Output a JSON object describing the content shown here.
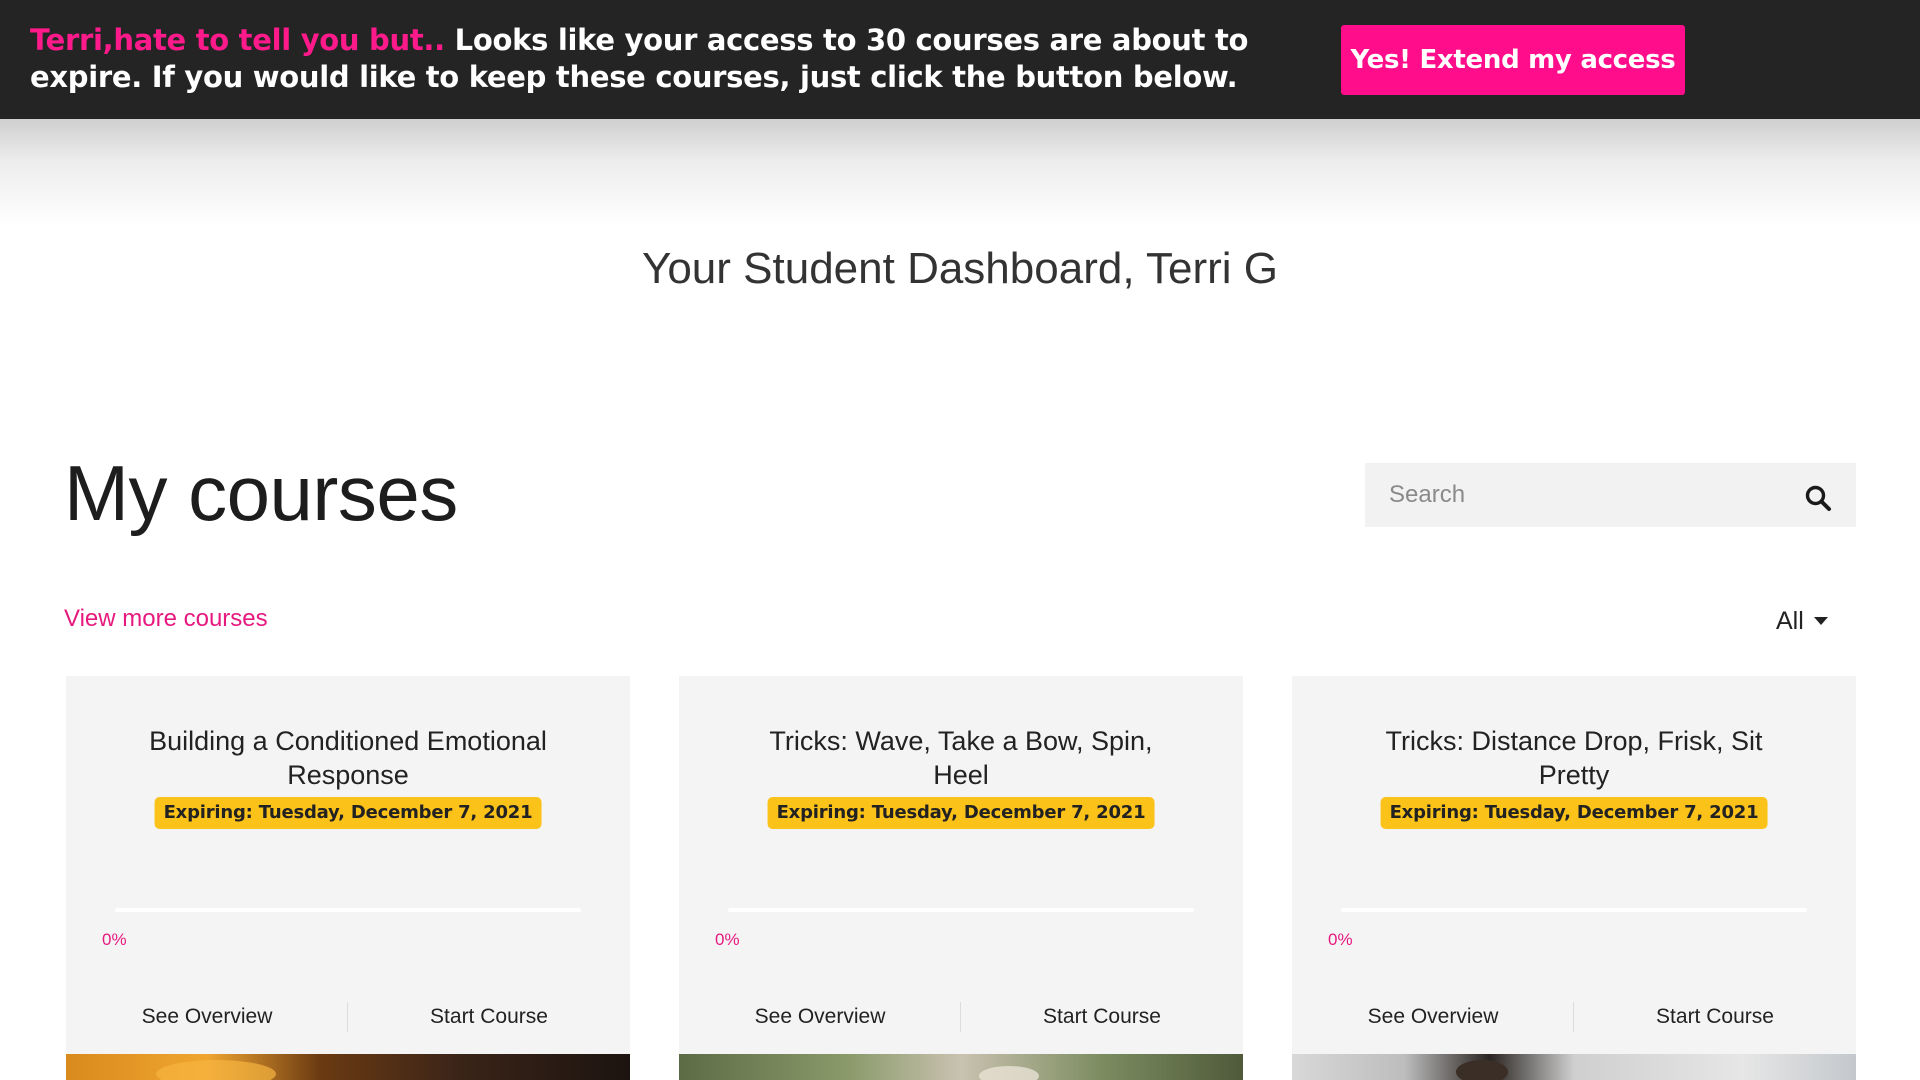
{
  "banner": {
    "highlight": "Terri,hate to tell you but..",
    "message": " Looks like your access to 30 courses are about to expire. If you would like to keep these courses, just click the button below.",
    "button_label": "Yes! Extend my access"
  },
  "dashboard": {
    "title": "Your Student Dashboard, Terri G"
  },
  "courses_section": {
    "heading": "My courses",
    "search_placeholder": "Search",
    "view_more_label": "View more courses",
    "filter_label": "All"
  },
  "courses": [
    {
      "title": "Building a Conditioned Emotional Response",
      "expiring": "Expiring: Tuesday, December 7, 2021",
      "progress_label": "0%",
      "progress_value": 0,
      "overview_label": "See Overview",
      "start_label": "Start Course"
    },
    {
      "title": "Tricks: Wave, Take a Bow, Spin, Heel",
      "expiring": "Expiring: Tuesday, December 7, 2021",
      "progress_label": "0%",
      "progress_value": 0,
      "overview_label": "See Overview",
      "start_label": "Start Course"
    },
    {
      "title": "Tricks: Distance Drop, Frisk, Sit Pretty",
      "expiring": "Expiring: Tuesday, December 7, 2021",
      "progress_label": "0%",
      "progress_value": 0,
      "overview_label": "See Overview",
      "start_label": "Start Course"
    }
  ],
  "icons": {
    "search": "search-icon",
    "filter_caret": "caret-down-icon"
  },
  "colors": {
    "accent": "#ff0d8a",
    "banner_bg": "#242424",
    "badge": "#fbc21a",
    "card_bg": "#f4f4f4"
  }
}
